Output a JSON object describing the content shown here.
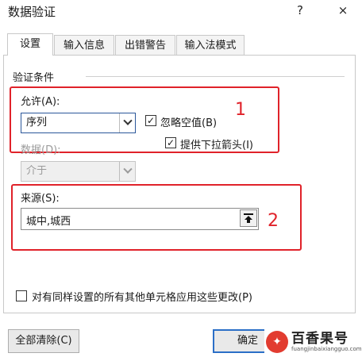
{
  "window": {
    "title": "数据验证",
    "help": "?",
    "close": "×"
  },
  "tabs": [
    {
      "label": "设置",
      "active": true
    },
    {
      "label": "输入信息",
      "active": false
    },
    {
      "label": "出错警告",
      "active": false
    },
    {
      "label": "输入法模式",
      "active": false
    }
  ],
  "criteria": {
    "group_label": "验证条件",
    "allow_label": "允许(A):",
    "allow_value": "序列",
    "ignore_blank_label": "忽略空值(B)",
    "ignore_blank_checked": true,
    "dropdown_label": "提供下拉箭头(I)",
    "dropdown_checked": true,
    "data_label": "数据(D):",
    "data_value": "介于",
    "source_label": "来源(S):",
    "source_value": "城中,城西"
  },
  "annotations": {
    "n1": "1",
    "n2": "2"
  },
  "apply_all": {
    "label": "对有同样设置的所有其他单元格应用这些更改(P)",
    "checked": false
  },
  "buttons": {
    "clear_all": "全部清除(C)",
    "ok": "确定"
  },
  "watermark": {
    "name": "百香果号",
    "url": "fuangjinbaixiangguo.com"
  },
  "icons": {
    "upload": "collapse-dialog-icon",
    "chevron": "chevron-down-icon"
  },
  "colors": {
    "annotation": "#e0222a",
    "accent": "#2b579a"
  }
}
